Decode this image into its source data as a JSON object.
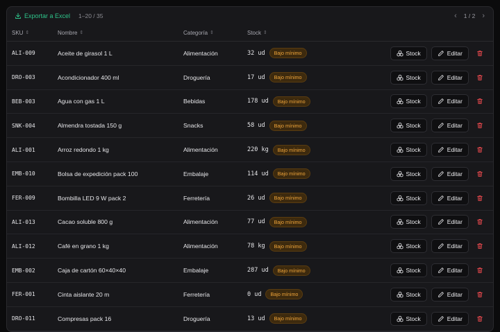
{
  "toolbar": {
    "export_label": "Exportar a Excel",
    "range": "1–20 / 35",
    "page": "1 / 2"
  },
  "columns": {
    "sku": "SKU",
    "name": "Nombre",
    "category": "Categoría",
    "stock": "Stock"
  },
  "actions": {
    "stock_label": "Stock",
    "edit_label": "Editar"
  },
  "badge_label": "Bajo mínimo",
  "colors": {
    "accent_green": "#2ec48a",
    "badge_text": "#f0a53a",
    "danger": "#e5484d"
  },
  "rows": [
    {
      "sku": "ALI-009",
      "name": "Aceite de girasol 1 L",
      "category": "Alimentación",
      "stock": "32 ud"
    },
    {
      "sku": "DRO-003",
      "name": "Acondicionador 400 ml",
      "category": "Droguería",
      "stock": "17 ud"
    },
    {
      "sku": "BEB-003",
      "name": "Agua con gas 1 L",
      "category": "Bebidas",
      "stock": "178 ud"
    },
    {
      "sku": "SNK-004",
      "name": "Almendra tostada 150 g",
      "category": "Snacks",
      "stock": "58 ud"
    },
    {
      "sku": "ALI-001",
      "name": "Arroz redondo 1 kg",
      "category": "Alimentación",
      "stock": "220 kg"
    },
    {
      "sku": "EMB-010",
      "name": "Bolsa de expedición pack 100",
      "category": "Embalaje",
      "stock": "114 ud"
    },
    {
      "sku": "FER-009",
      "name": "Bombilla LED 9 W pack 2",
      "category": "Ferretería",
      "stock": "26 ud"
    },
    {
      "sku": "ALI-013",
      "name": "Cacao soluble 800 g",
      "category": "Alimentación",
      "stock": "77 ud"
    },
    {
      "sku": "ALI-012",
      "name": "Café en grano 1 kg",
      "category": "Alimentación",
      "stock": "78 kg"
    },
    {
      "sku": "EMB-002",
      "name": "Caja de cartón 60×40×40",
      "category": "Embalaje",
      "stock": "287 ud"
    },
    {
      "sku": "FER-001",
      "name": "Cinta aislante 20 m",
      "category": "Ferretería",
      "stock": "0 ud"
    },
    {
      "sku": "DRO-011",
      "name": "Compresas pack 16",
      "category": "Droguería",
      "stock": "13 ud"
    }
  ]
}
